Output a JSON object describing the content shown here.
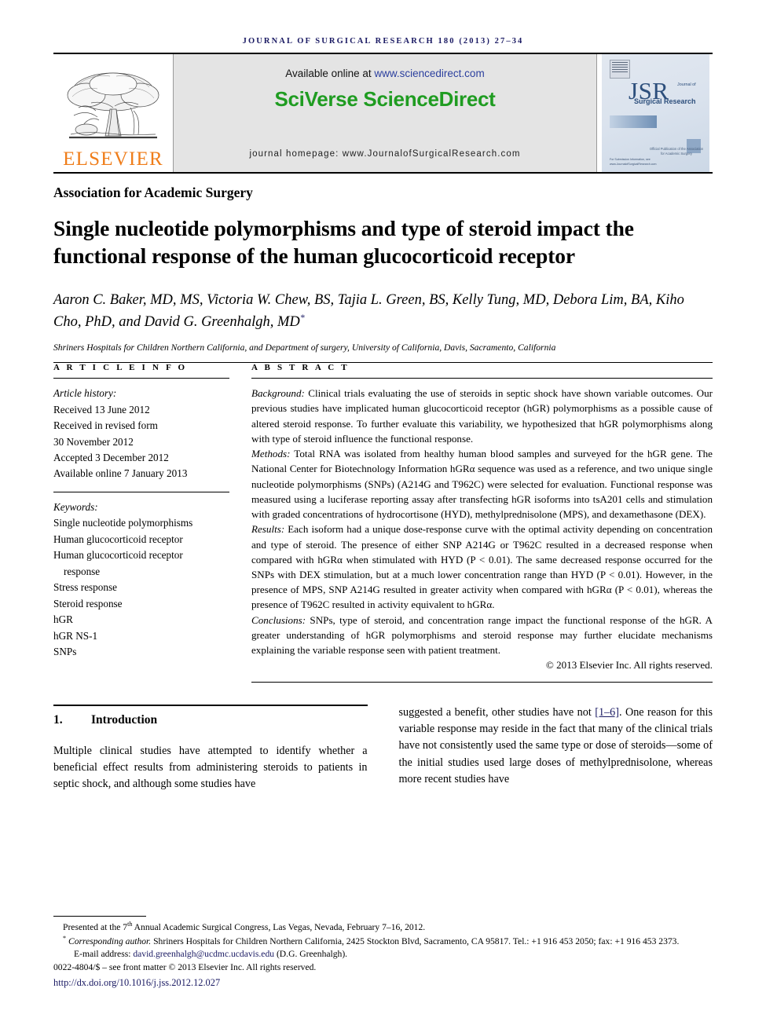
{
  "running_head": "JOURNAL OF SURGICAL RESEARCH 180 (2013) 27–34",
  "masthead": {
    "publisher_name": "ELSEVIER",
    "available_prefix": "Available online at ",
    "available_url": "www.sciencedirect.com",
    "sciencedirect_logo": "SciVerse ScienceDirect",
    "journal_homepage": "journal homepage: www.JournalofSurgicalResearch.com",
    "cover": {
      "title_abbrev": "JSR",
      "title_small": "Journal of",
      "title_sub": "Surgical Research",
      "note": "Official Publication of the Association for Academic Surgery",
      "footer": "For Submission Information, see www.JournalofSurgicalResearch.com"
    }
  },
  "society_line": "Association for Academic Surgery",
  "article": {
    "title": "Single nucleotide polymorphisms and type of steroid impact the functional response of the human glucocorticoid receptor",
    "authors": "Aaron C. Baker, MD, MS, Victoria W. Chew, BS, Tajia L. Green, BS, Kelly Tung, MD, Debora Lim, BA, Kiho Cho, PhD, and David G. Greenhalgh, MD",
    "corresponding_marker": "*",
    "affiliation": "Shriners Hospitals for Children Northern California, and Department of surgery, University of California, Davis, Sacramento, California"
  },
  "article_info": {
    "label": "A R T I C L E  I N F O",
    "history_label": "Article history:",
    "history": [
      "Received 13 June 2012",
      "Received in revised form",
      "30 November 2012",
      "Accepted 3 December 2012",
      "Available online 7 January 2013"
    ],
    "keywords_label": "Keywords:",
    "keywords": [
      "Single nucleotide polymorphisms",
      "Human glucocorticoid receptor",
      "Human glucocorticoid receptor",
      "response",
      "Stress response",
      "Steroid response",
      "hGR",
      "hGR NS-1",
      "SNPs"
    ]
  },
  "abstract": {
    "label": "A B S T R A C T",
    "sections": [
      {
        "heading": "Background:",
        "text": " Clinical trials evaluating the use of steroids in septic shock have shown variable outcomes. Our previous studies have implicated human glucocorticoid receptor (hGR) polymorphisms as a possible cause of altered steroid response. To further evaluate this variability, we hypothesized that hGR polymorphisms along with type of steroid influence the functional response."
      },
      {
        "heading": "Methods:",
        "text": " Total RNA was isolated from healthy human blood samples and surveyed for the hGR gene. The National Center for Biotechnology Information hGRα sequence was used as a reference, and two unique single nucleotide polymorphisms (SNPs) (A214G and T962C) were selected for evaluation. Functional response was measured using a luciferase reporting assay after transfecting hGR isoforms into tsA201 cells and stimulation with graded concentrations of hydrocortisone (HYD), methylprednisolone (MPS), and dexamethasone (DEX)."
      },
      {
        "heading": "Results:",
        "text": " Each isoform had a unique dose-response curve with the optimal activity depending on concentration and type of steroid. The presence of either SNP A214G or T962C resulted in a decreased response when compared with hGRα when stimulated with HYD (P < 0.01). The same decreased response occurred for the SNPs with DEX stimulation, but at a much lower concentration range than HYD (P < 0.01). However, in the presence of MPS, SNP A214G resulted in greater activity when compared with hGRα (P < 0.01), whereas the presence of T962C resulted in activity equivalent to hGRα."
      },
      {
        "heading": "Conclusions:",
        "text": " SNPs, type of steroid, and concentration range impact the functional response of the hGR. A greater understanding of hGR polymorphisms and steroid response may further elucidate mechanisms explaining the variable response seen with patient treatment."
      }
    ],
    "copyright": "© 2013 Elsevier Inc. All rights reserved."
  },
  "introduction": {
    "number": "1.",
    "heading": "Introduction",
    "col_left": "Multiple clinical studies have attempted to identify whether a beneficial effect results from administering steroids to patients in septic shock, and although some studies have",
    "col_right_pre": "suggested a benefit, other studies have not ",
    "col_right_ref": "[1–6]",
    "col_right_post": ". One reason for this variable response may reside in the fact that many of the clinical trials have not consistently used the same type or dose of steroids—some of the initial studies used large doses of methylprednisolone, whereas more recent studies have"
  },
  "footnotes": {
    "presented_pre": "Presented at the 7",
    "presented_sup": "th",
    "presented_post": " Annual Academic Surgical Congress, Las Vegas, Nevada, February 7–16, 2012.",
    "corresponding_marker": "*",
    "corresponding_label": "Corresponding author.",
    "corresponding_text": " Shriners Hospitals for Children Northern California, 2425 Stockton Blvd, Sacramento, CA 95817. Tel.: +1 916 453 2050; fax: +1 916 453 2373.",
    "email_label": "E-mail address: ",
    "email": "david.greenhalgh@ucdmc.ucdavis.edu",
    "email_suffix": " (D.G. Greenhalgh).",
    "issn_line": "0022-4804/$ – see front matter © 2013 Elsevier Inc. All rights reserved.",
    "doi": "http://dx.doi.org/10.1016/j.jss.2012.12.027"
  },
  "colors": {
    "link_blue": "#1a1a63",
    "elsevier_orange": "#ef7d1a",
    "sciencedirect_green": "#1f9c21",
    "sd_box_bg": "#e4e4e4"
  }
}
